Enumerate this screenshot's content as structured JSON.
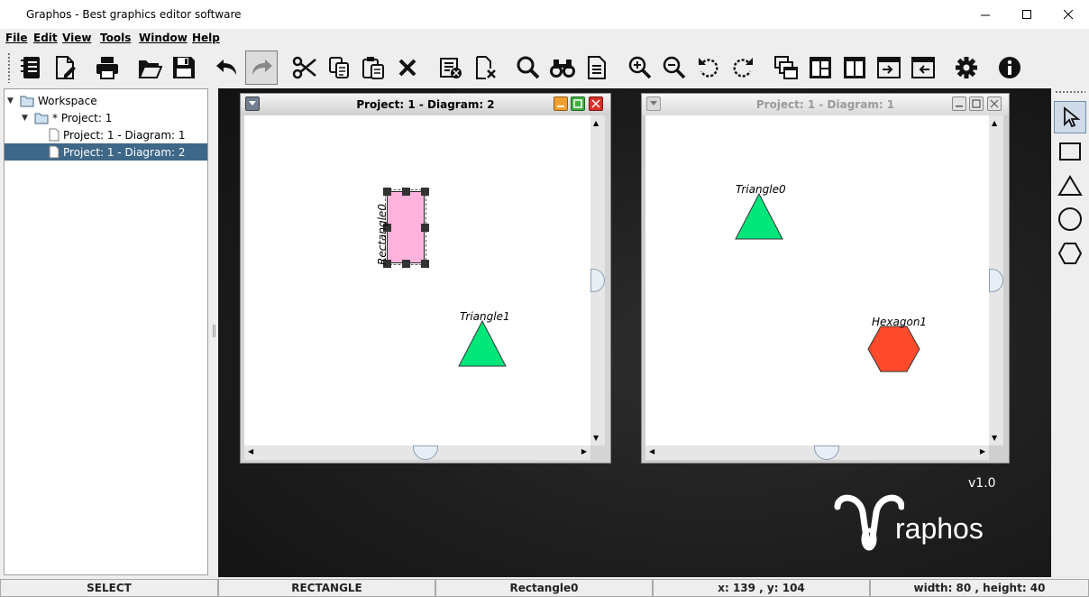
{
  "window": {
    "title": "Graphos - Best graphics editor software"
  },
  "menu": [
    "File",
    "Edit",
    "View",
    "Tools",
    "Window",
    "Help"
  ],
  "toolbar_icons": [
    "notebook-icon",
    "new-document-icon",
    "print-icon",
    "open-folder-icon",
    "save-icon",
    "undo-icon",
    "redo-icon",
    "cut-icon",
    "copy-icon",
    "paste-icon",
    "delete-icon",
    "close-project-icon",
    "close-diagram-icon",
    "search-icon",
    "binoculars-icon",
    "document-icon",
    "zoom-in-icon",
    "zoom-out-icon",
    "rotate-left-icon",
    "rotate-right-icon",
    "cascade-icon",
    "tile-horizontal-icon",
    "tile-vertical-icon",
    "import-icon",
    "export-icon",
    "settings-icon",
    "info-icon"
  ],
  "tree": {
    "root": "Workspace",
    "project": "* Project: 1",
    "items": [
      "Project: 1 - Diagram: 1",
      "Project: 1 - Diagram: 2"
    ],
    "selected": "Project: 1 - Diagram: 2"
  },
  "diagrams": {
    "active": {
      "title": "Project: 1 - Diagram: 2",
      "shapes": [
        {
          "name": "Rectangle0",
          "type": "rectangle",
          "color": "#ffb3dc"
        },
        {
          "name": "Triangle1",
          "type": "triangle",
          "color": "#00e67a"
        }
      ]
    },
    "inactive": {
      "title": "Project: 1 - Diagram: 1",
      "shapes": [
        {
          "name": "Triangle0",
          "type": "triangle",
          "color": "#00e67a"
        },
        {
          "name": "Hexagon1",
          "type": "hexagon",
          "color": "#ff4a2b"
        }
      ]
    }
  },
  "palette": [
    "select-tool-icon",
    "rectangle-tool-icon",
    "triangle-tool-icon",
    "circle-tool-icon",
    "hexagon-tool-icon"
  ],
  "logo": {
    "version": "v1.0",
    "text": "raphos"
  },
  "status": {
    "mode": "SELECT",
    "tool": "RECTANGLE",
    "element": "Rectangle0",
    "coords": "x: 139 , y: 104",
    "size": "width: 80 , height: 40"
  }
}
